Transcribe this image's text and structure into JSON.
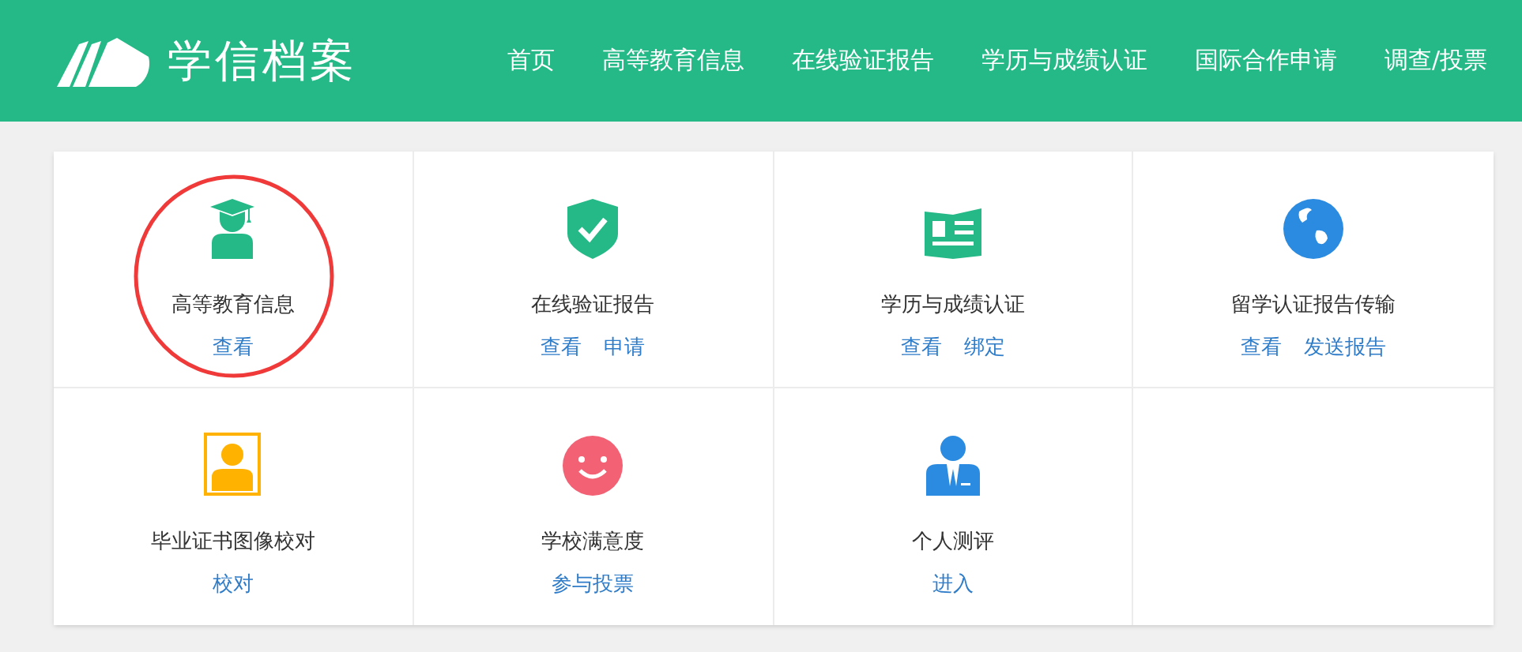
{
  "header": {
    "logo_text": "学信档案",
    "nav": [
      {
        "label": "首页"
      },
      {
        "label": "高等教育信息"
      },
      {
        "label": "在线验证报告"
      },
      {
        "label": "学历与成绩认证"
      },
      {
        "label": "国际合作申请"
      },
      {
        "label": "调查/投票"
      }
    ]
  },
  "tiles": [
    {
      "kind": "graduate",
      "title": "高等教育信息",
      "links": [
        "查看"
      ],
      "circled": true
    },
    {
      "kind": "shield",
      "title": "在线验证报告",
      "links": [
        "查看",
        "申请"
      ],
      "circled": false
    },
    {
      "kind": "book",
      "title": "学历与成绩认证",
      "links": [
        "查看",
        "绑定"
      ],
      "circled": false
    },
    {
      "kind": "globe",
      "title": "留学认证报告传输",
      "links": [
        "查看",
        "发送报告"
      ],
      "circled": false
    },
    {
      "kind": "portrait",
      "title": "毕业证书图像校对",
      "links": [
        "校对"
      ],
      "circled": false
    },
    {
      "kind": "smile",
      "title": "学校满意度",
      "links": [
        "参与投票"
      ],
      "circled": false
    },
    {
      "kind": "person",
      "title": "个人测评",
      "links": [
        "进入"
      ],
      "circled": false
    }
  ]
}
